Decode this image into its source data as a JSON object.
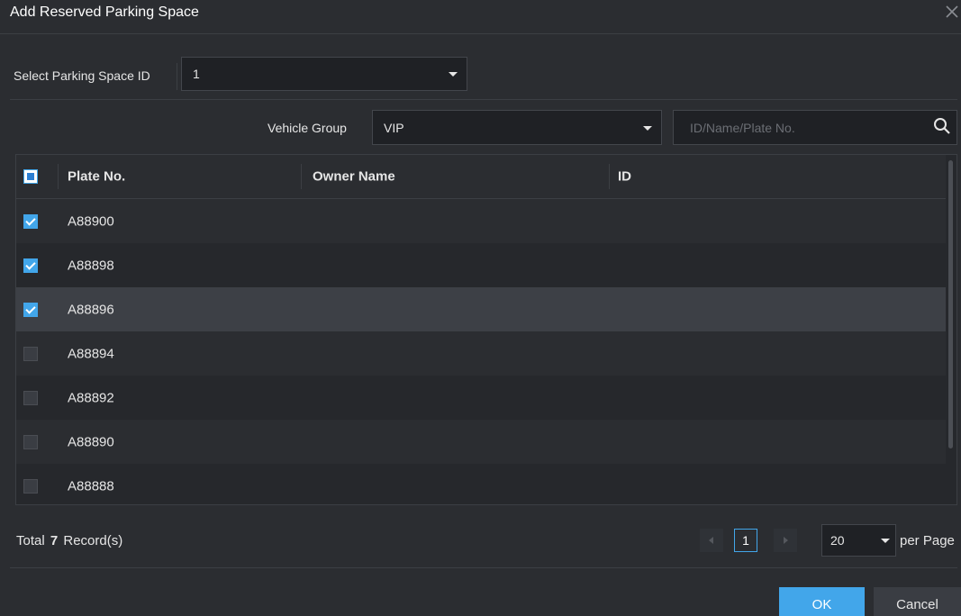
{
  "dialog": {
    "title": "Add Reserved Parking Space",
    "close_icon": "close-icon"
  },
  "parking_space": {
    "label": "Select Parking Space ID",
    "value": "1"
  },
  "filter": {
    "group_label": "Vehicle Group",
    "group_value": "VIP",
    "search_placeholder": "ID/Name/Plate No.",
    "search_icon": "search-icon"
  },
  "table": {
    "headers": [
      "Plate No.",
      "Owner Name",
      "ID"
    ],
    "select_all_state": "partial",
    "rows": [
      {
        "plate": "A88900",
        "owner": "",
        "id": "",
        "checked": true
      },
      {
        "plate": "A88898",
        "owner": "",
        "id": "",
        "checked": true
      },
      {
        "plate": "A88896",
        "owner": "",
        "id": "",
        "checked": true
      },
      {
        "plate": "A88894",
        "owner": "",
        "id": "",
        "checked": false
      },
      {
        "plate": "A88892",
        "owner": "",
        "id": "",
        "checked": false
      },
      {
        "plate": "A88890",
        "owner": "",
        "id": "",
        "checked": false
      },
      {
        "plate": "A88888",
        "owner": "",
        "id": "",
        "checked": false
      }
    ]
  },
  "footer": {
    "total_prefix": "Total",
    "total_count": "7",
    "total_suffix": "Record(s)",
    "current_page": "1",
    "page_size": "20",
    "per_page_label": "per Page"
  },
  "buttons": {
    "ok": "OK",
    "cancel": "Cancel"
  },
  "colors": {
    "accent": "#42a6ea",
    "background": "#2b2d31",
    "row_highlight": "#3d4046"
  }
}
